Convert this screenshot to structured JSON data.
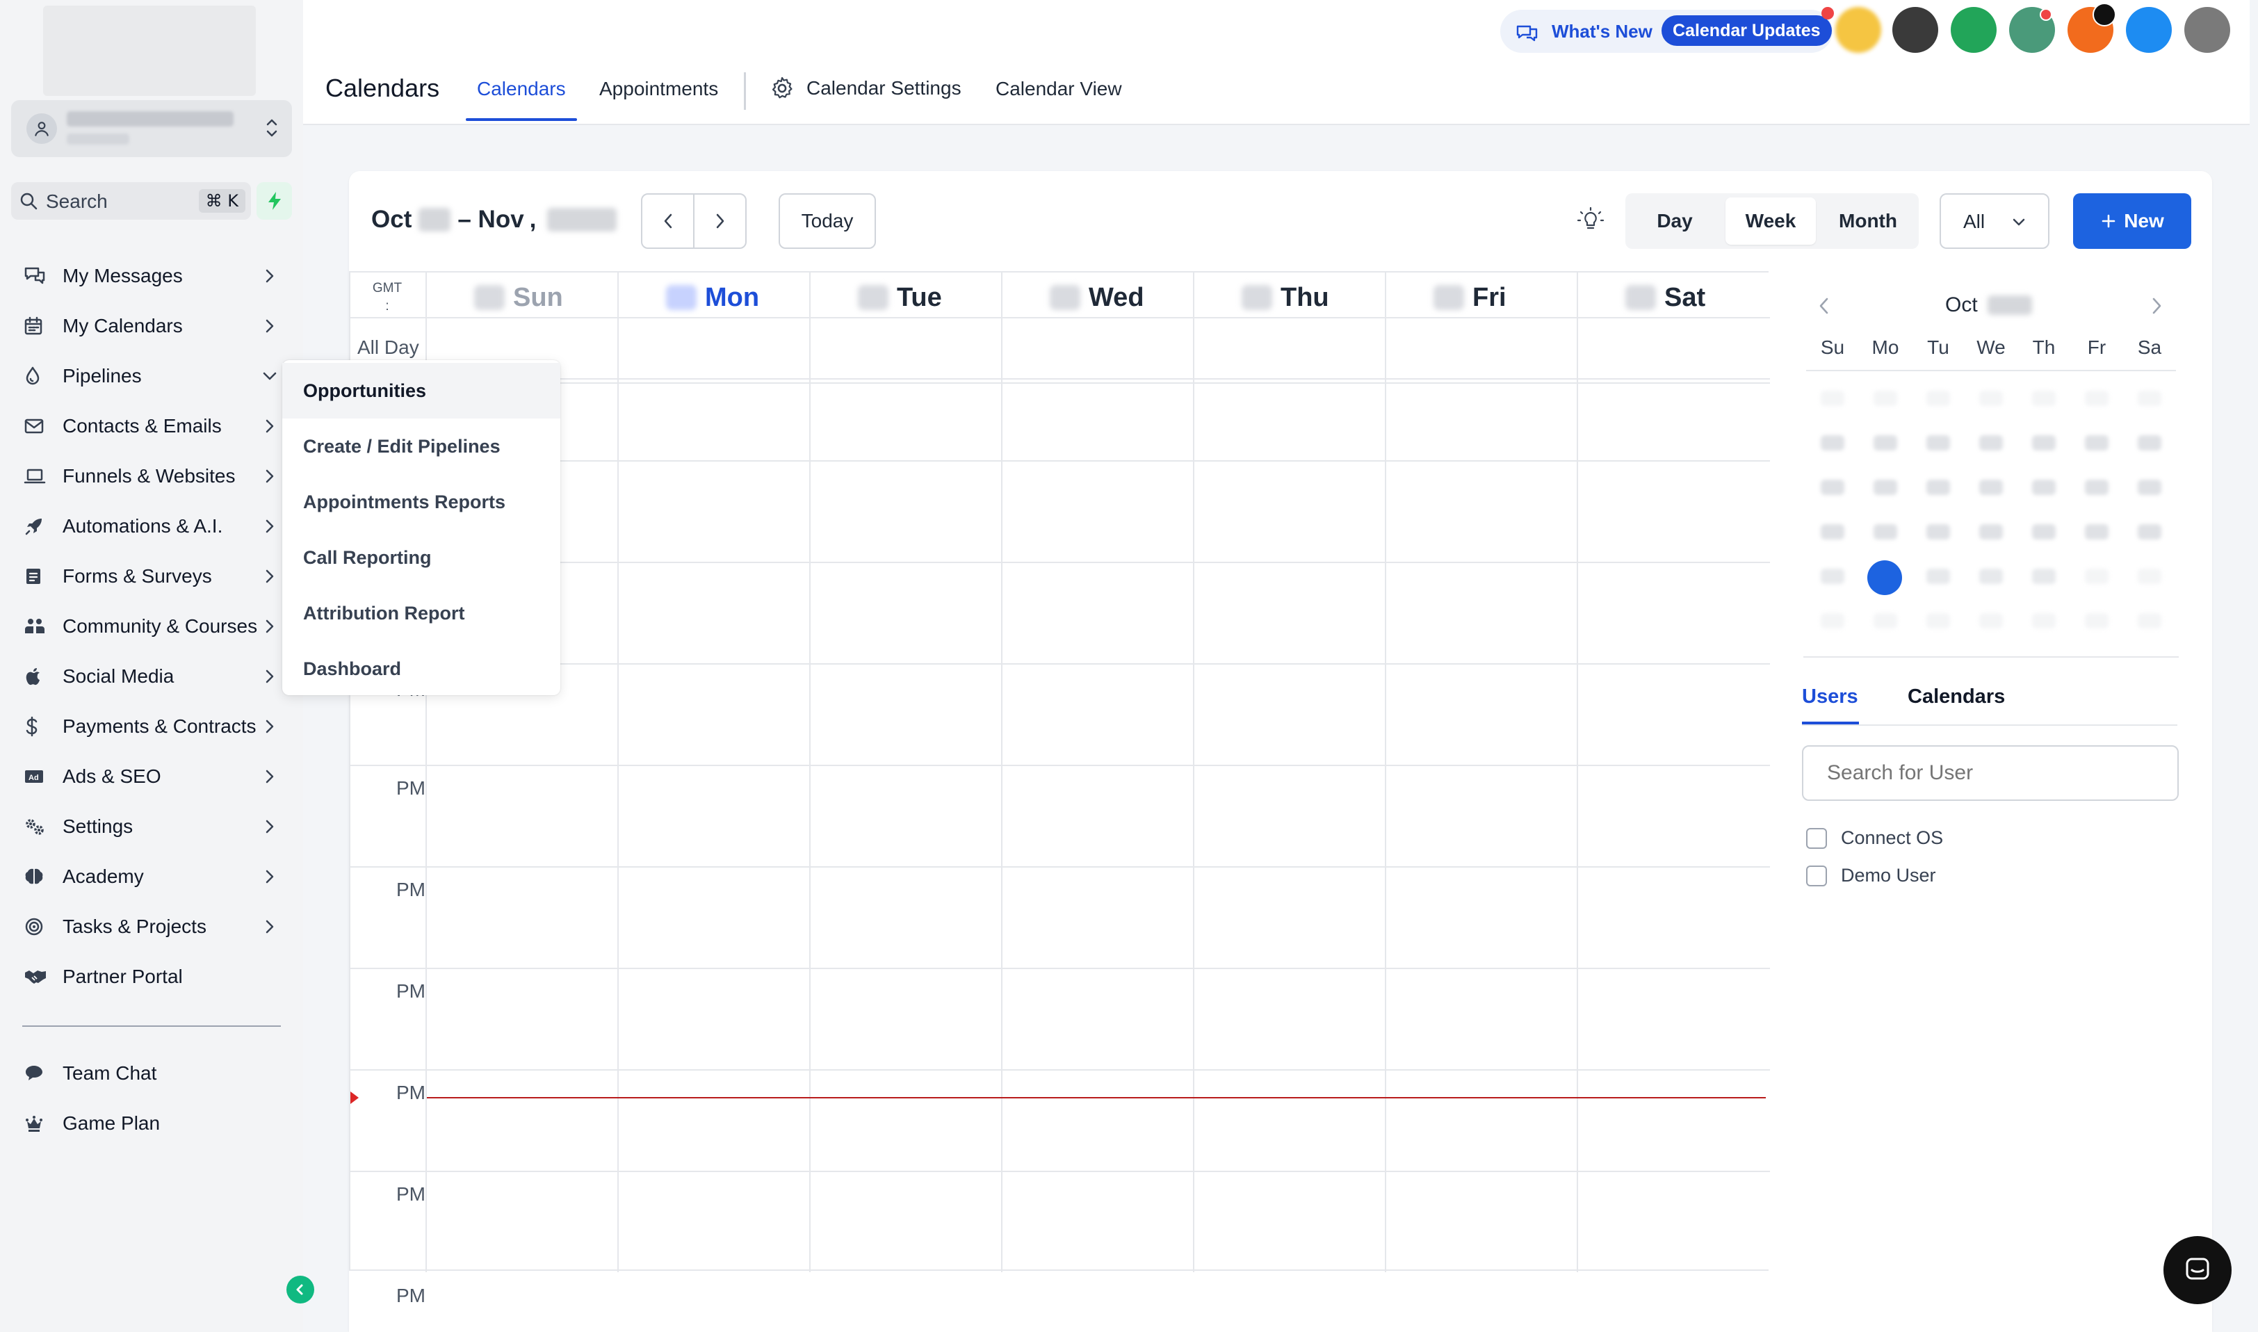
{
  "sidebar": {
    "search_label": "Search",
    "search_shortcut": "⌘ K",
    "items": [
      {
        "label": "My Messages",
        "icon": "chat-bubbles-icon"
      },
      {
        "label": "My Calendars",
        "icon": "calendar-icon"
      },
      {
        "label": "Pipelines",
        "icon": "funnel-drop-icon"
      },
      {
        "label": "Contacts & Emails",
        "icon": "envelope-icon"
      },
      {
        "label": "Funnels & Websites",
        "icon": "laptop-icon"
      },
      {
        "label": "Automations & A.I.",
        "icon": "rocket-icon"
      },
      {
        "label": "Forms & Surveys",
        "icon": "form-icon"
      },
      {
        "label": "Community & Courses",
        "icon": "community-icon"
      },
      {
        "label": "Social Media",
        "icon": "apple-icon"
      },
      {
        "label": "Payments & Contracts",
        "icon": "dollar-icon"
      },
      {
        "label": "Ads & SEO",
        "icon": "ad-icon"
      },
      {
        "label": "Settings",
        "icon": "gears-icon"
      },
      {
        "label": "Academy",
        "icon": "brain-icon"
      },
      {
        "label": "Tasks & Projects",
        "icon": "target-icon"
      },
      {
        "label": "Partner Portal",
        "icon": "handshake-icon"
      }
    ],
    "bottom_items": [
      {
        "label": "Team Chat",
        "icon": "chat-icon"
      },
      {
        "label": "Game Plan",
        "icon": "crown-icon"
      }
    ]
  },
  "pipelines_menu": {
    "items": [
      "Opportunities",
      "Create / Edit Pipelines",
      "Appointments Reports",
      "Call Reporting",
      "Attribution Report",
      "Dashboard"
    ],
    "highlighted": "Opportunities"
  },
  "header": {
    "title": "Calendars",
    "tabs": [
      "Calendars",
      "Appointments"
    ],
    "active_tab": "Calendars",
    "settings_label": "Calendar Settings",
    "view_label": "Calendar View",
    "whats_new": "What's New",
    "calendar_updates": "Calendar Updates"
  },
  "avatars": [
    {
      "color": "#f5c542"
    },
    {
      "color": "#3a3a3a"
    },
    {
      "color": "#22a559"
    },
    {
      "color": "#4a9a7a"
    },
    {
      "color": "#f26b1d"
    },
    {
      "color": "#1d8cf2"
    },
    {
      "color": "#7a7a7a"
    }
  ],
  "toolbar": {
    "range_start": "Oct",
    "range_sep": "– Nov",
    "range_comma": ",",
    "today": "Today",
    "views": [
      "Day",
      "Week",
      "Month"
    ],
    "active_view": "Week",
    "filter": "All",
    "new": "New"
  },
  "grid": {
    "tz_label": "GMT",
    "tz_offset": ":",
    "all_day": "All Day",
    "days": [
      "Sun",
      "Mon",
      "Tue",
      "Wed",
      "Thu",
      "Fri",
      "Sat"
    ],
    "today_index": 1,
    "time_labels": [
      "PM",
      "PM",
      "PM",
      "PM",
      "PM",
      "PM"
    ],
    "partial_label": "PM"
  },
  "mini_calendar": {
    "month": "Oct",
    "weekdays": [
      "Su",
      "Mo",
      "Tu",
      "We",
      "Th",
      "Fr",
      "Sa"
    ]
  },
  "users_panel": {
    "tabs": [
      "Users",
      "Calendars"
    ],
    "active_tab": "Users",
    "search_placeholder": "Search for User",
    "users": [
      "Connect OS",
      "Demo User"
    ]
  },
  "colors": {
    "accent": "#1d4ed8",
    "primary_button": "#1d63e0",
    "now_line": "#b91c1c",
    "sidebar_bg": "#f3f4f6"
  }
}
